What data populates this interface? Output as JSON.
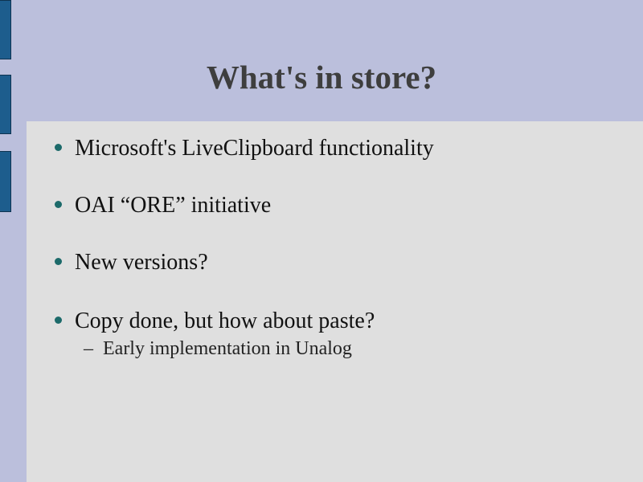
{
  "slide": {
    "title": "What's in store?",
    "bullets": [
      "Microsoft's LiveClipboard functionality",
      "OAI “ORE” initiative",
      "New versions?",
      "Copy done, but how about paste?"
    ],
    "sub_bullets": [
      "Early implementation in Unalog"
    ],
    "sub_marker": "–"
  },
  "colors": {
    "background": "#bbbfdc",
    "content_panel": "#dfdfdf",
    "side_tabs": "#1d5d8d",
    "bullet_dot": "#1c6a6a",
    "title_text": "#3e3e3e"
  }
}
